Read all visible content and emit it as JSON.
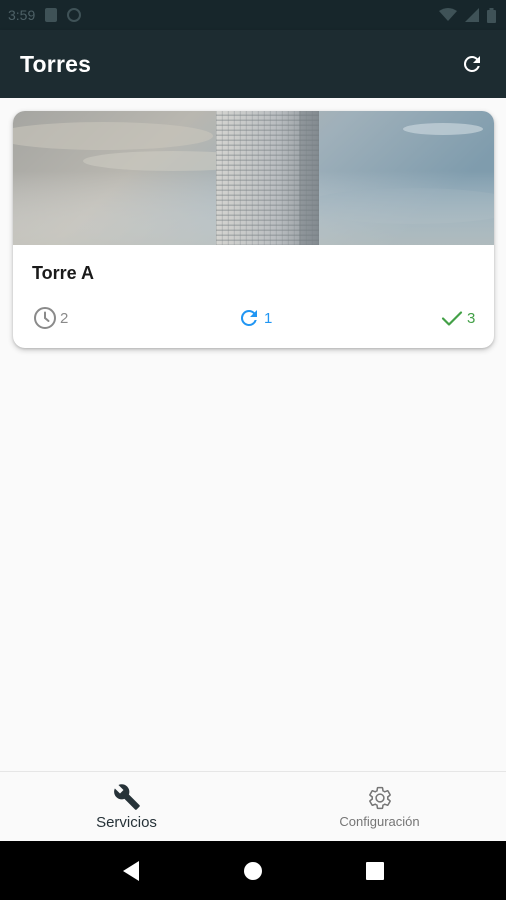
{
  "status_bar": {
    "time": "3:59",
    "icons": [
      "sim-card-icon",
      "data-saver-icon",
      "wifi-icon",
      "signal-icon",
      "battery-icon"
    ]
  },
  "app_bar": {
    "title": "Torres",
    "action_icon": "refresh-icon"
  },
  "towers": [
    {
      "name": "Torre A",
      "image": "tower-photo",
      "stats": {
        "pending": "2",
        "in_progress": "1",
        "completed": "3"
      }
    }
  ],
  "bottom_nav": {
    "items": [
      {
        "label": "Servicios",
        "icon": "wrench-icon",
        "active": true
      },
      {
        "label": "Configuración",
        "icon": "gear-icon",
        "active": false
      }
    ]
  },
  "colors": {
    "app_bar": "#1d2c31",
    "pending": "#8a8a8a",
    "in_progress": "#2196f3",
    "completed": "#43a047"
  }
}
